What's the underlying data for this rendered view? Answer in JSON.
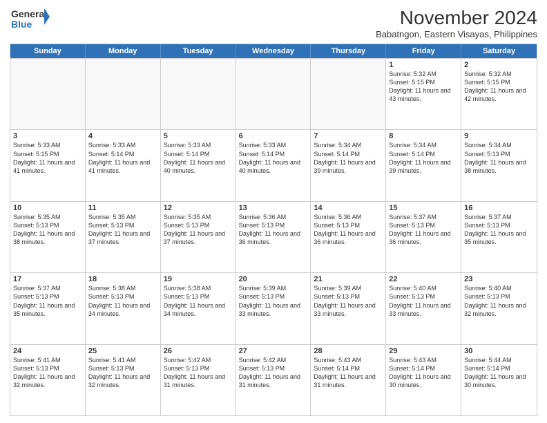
{
  "logo": {
    "line1": "General",
    "line2": "Blue"
  },
  "title": "November 2024",
  "subtitle": "Babatngon, Eastern Visayas, Philippines",
  "days": [
    "Sunday",
    "Monday",
    "Tuesday",
    "Wednesday",
    "Thursday",
    "Friday",
    "Saturday"
  ],
  "weeks": [
    [
      {
        "day": "",
        "info": ""
      },
      {
        "day": "",
        "info": ""
      },
      {
        "day": "",
        "info": ""
      },
      {
        "day": "",
        "info": ""
      },
      {
        "day": "",
        "info": ""
      },
      {
        "day": "1",
        "info": "Sunrise: 5:32 AM\nSunset: 5:15 PM\nDaylight: 11 hours and 43 minutes."
      },
      {
        "day": "2",
        "info": "Sunrise: 5:32 AM\nSunset: 5:15 PM\nDaylight: 11 hours and 42 minutes."
      }
    ],
    [
      {
        "day": "3",
        "info": "Sunrise: 5:33 AM\nSunset: 5:15 PM\nDaylight: 11 hours and 41 minutes."
      },
      {
        "day": "4",
        "info": "Sunrise: 5:33 AM\nSunset: 5:14 PM\nDaylight: 11 hours and 41 minutes."
      },
      {
        "day": "5",
        "info": "Sunrise: 5:33 AM\nSunset: 5:14 PM\nDaylight: 11 hours and 40 minutes."
      },
      {
        "day": "6",
        "info": "Sunrise: 5:33 AM\nSunset: 5:14 PM\nDaylight: 11 hours and 40 minutes."
      },
      {
        "day": "7",
        "info": "Sunrise: 5:34 AM\nSunset: 5:14 PM\nDaylight: 11 hours and 39 minutes."
      },
      {
        "day": "8",
        "info": "Sunrise: 5:34 AM\nSunset: 5:14 PM\nDaylight: 11 hours and 39 minutes."
      },
      {
        "day": "9",
        "info": "Sunrise: 5:34 AM\nSunset: 5:13 PM\nDaylight: 11 hours and 38 minutes."
      }
    ],
    [
      {
        "day": "10",
        "info": "Sunrise: 5:35 AM\nSunset: 5:13 PM\nDaylight: 11 hours and 38 minutes."
      },
      {
        "day": "11",
        "info": "Sunrise: 5:35 AM\nSunset: 5:13 PM\nDaylight: 11 hours and 37 minutes."
      },
      {
        "day": "12",
        "info": "Sunrise: 5:35 AM\nSunset: 5:13 PM\nDaylight: 11 hours and 37 minutes."
      },
      {
        "day": "13",
        "info": "Sunrise: 5:36 AM\nSunset: 5:13 PM\nDaylight: 11 hours and 36 minutes."
      },
      {
        "day": "14",
        "info": "Sunrise: 5:36 AM\nSunset: 5:13 PM\nDaylight: 11 hours and 36 minutes."
      },
      {
        "day": "15",
        "info": "Sunrise: 5:37 AM\nSunset: 5:13 PM\nDaylight: 11 hours and 36 minutes."
      },
      {
        "day": "16",
        "info": "Sunrise: 5:37 AM\nSunset: 5:13 PM\nDaylight: 11 hours and 35 minutes."
      }
    ],
    [
      {
        "day": "17",
        "info": "Sunrise: 5:37 AM\nSunset: 5:13 PM\nDaylight: 11 hours and 35 minutes."
      },
      {
        "day": "18",
        "info": "Sunrise: 5:38 AM\nSunset: 5:13 PM\nDaylight: 11 hours and 34 minutes."
      },
      {
        "day": "19",
        "info": "Sunrise: 5:38 AM\nSunset: 5:13 PM\nDaylight: 11 hours and 34 minutes."
      },
      {
        "day": "20",
        "info": "Sunrise: 5:39 AM\nSunset: 5:13 PM\nDaylight: 11 hours and 33 minutes."
      },
      {
        "day": "21",
        "info": "Sunrise: 5:39 AM\nSunset: 5:13 PM\nDaylight: 11 hours and 33 minutes."
      },
      {
        "day": "22",
        "info": "Sunrise: 5:40 AM\nSunset: 5:13 PM\nDaylight: 11 hours and 33 minutes."
      },
      {
        "day": "23",
        "info": "Sunrise: 5:40 AM\nSunset: 5:13 PM\nDaylight: 11 hours and 32 minutes."
      }
    ],
    [
      {
        "day": "24",
        "info": "Sunrise: 5:41 AM\nSunset: 5:13 PM\nDaylight: 11 hours and 32 minutes."
      },
      {
        "day": "25",
        "info": "Sunrise: 5:41 AM\nSunset: 5:13 PM\nDaylight: 11 hours and 32 minutes."
      },
      {
        "day": "26",
        "info": "Sunrise: 5:42 AM\nSunset: 5:13 PM\nDaylight: 11 hours and 31 minutes."
      },
      {
        "day": "27",
        "info": "Sunrise: 5:42 AM\nSunset: 5:13 PM\nDaylight: 11 hours and 31 minutes."
      },
      {
        "day": "28",
        "info": "Sunrise: 5:43 AM\nSunset: 5:14 PM\nDaylight: 11 hours and 31 minutes."
      },
      {
        "day": "29",
        "info": "Sunrise: 5:43 AM\nSunset: 5:14 PM\nDaylight: 11 hours and 30 minutes."
      },
      {
        "day": "30",
        "info": "Sunrise: 5:44 AM\nSunset: 5:14 PM\nDaylight: 11 hours and 30 minutes."
      }
    ]
  ]
}
